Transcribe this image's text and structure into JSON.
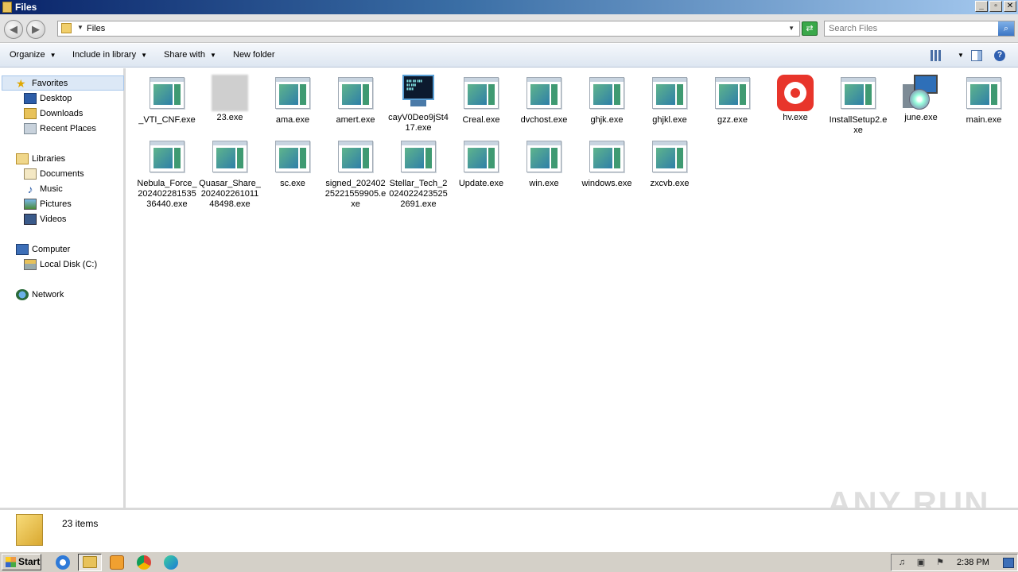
{
  "window": {
    "title": "Files",
    "buttons": [
      "_",
      "▫",
      "✕"
    ]
  },
  "address": {
    "path": "Files",
    "search_placeholder": "Search Files"
  },
  "toolbar": {
    "organize": "Organize",
    "include_in_library": "Include in library",
    "share_with": "Share with",
    "new_folder": "New folder"
  },
  "nav": {
    "favorites": "Favorites",
    "desktop": "Desktop",
    "downloads": "Downloads",
    "recent_places": "Recent Places",
    "libraries": "Libraries",
    "documents": "Documents",
    "music": "Music",
    "pictures": "Pictures",
    "videos": "Videos",
    "computer": "Computer",
    "local_disk": "Local Disk (C:)",
    "network": "Network"
  },
  "files": [
    {
      "name": "_VTI_CNF.exe",
      "icon": "exe"
    },
    {
      "name": "23.exe",
      "icon": "blurred"
    },
    {
      "name": "ama.exe",
      "icon": "exe"
    },
    {
      "name": "amert.exe",
      "icon": "exe"
    },
    {
      "name": "cayV0Deo9jSt417.exe",
      "icon": "console"
    },
    {
      "name": "Creal.exe",
      "icon": "exe"
    },
    {
      "name": "dvchost.exe",
      "icon": "exe"
    },
    {
      "name": "ghjk.exe",
      "icon": "exe"
    },
    {
      "name": "ghjkl.exe",
      "icon": "exe"
    },
    {
      "name": "gzz.exe",
      "icon": "exe"
    },
    {
      "name": "hv.exe",
      "icon": "hv"
    },
    {
      "name": "InstallSetup2.exe",
      "icon": "exe"
    },
    {
      "name": "june.exe",
      "icon": "installer"
    },
    {
      "name": "main.exe",
      "icon": "exe"
    },
    {
      "name": "Nebula_Force_20240228153536440.exe",
      "icon": "exe"
    },
    {
      "name": "Quasar_Share_20240226101148498.exe",
      "icon": "exe"
    },
    {
      "name": "sc.exe",
      "icon": "exe"
    },
    {
      "name": "signed_20240225221559905.exe",
      "icon": "exe"
    },
    {
      "name": "Stellar_Tech_20240224235252691.exe",
      "icon": "exe"
    },
    {
      "name": "Update.exe",
      "icon": "exe"
    },
    {
      "name": "win.exe",
      "icon": "exe"
    },
    {
      "name": "windows.exe",
      "icon": "exe"
    },
    {
      "name": "zxcvb.exe",
      "icon": "exe"
    }
  ],
  "status": {
    "item_count": "23 items"
  },
  "watermark": "ANY RUN",
  "taskbar": {
    "start": "Start",
    "clock": "2:38 PM"
  }
}
